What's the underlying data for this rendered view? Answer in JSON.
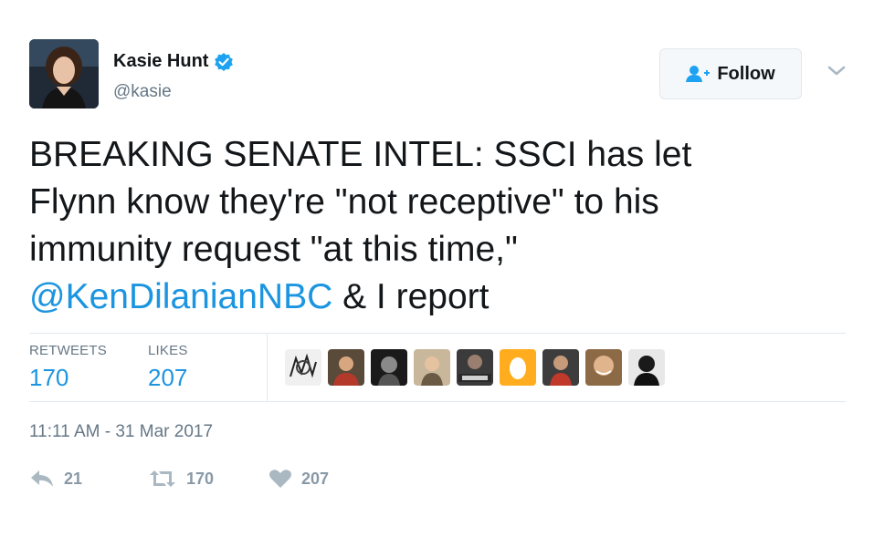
{
  "user": {
    "display_name": "Kasie Hunt",
    "handle": "@kasie",
    "verified": true,
    "avatar_icon": "profile-photo"
  },
  "follow_button": {
    "label": "Follow",
    "icon": "add-user-icon"
  },
  "more_menu": {
    "icon": "chevron-down-icon"
  },
  "tweet": {
    "line1": "BREAKING SENATE INTEL: SSCI has let",
    "line2": "Flynn know they're \"not receptive\" to his",
    "line3": "immunity request \"at this time,\"",
    "mention": "@KenDilanianNBC",
    "line4_rest": " & I report"
  },
  "stats": {
    "retweets_label": "RETWEETS",
    "retweets_value": "170",
    "likes_label": "LIKES",
    "likes_value": "207"
  },
  "timestamp": "11:11 AM - 31 Mar 2017",
  "actions": {
    "reply_count": "21",
    "retweet_count": "170",
    "like_count": "207"
  },
  "colors": {
    "link": "#1b95e0",
    "muted": "#657786",
    "action_gray": "#8899a6",
    "verified": "#1da1f2"
  }
}
